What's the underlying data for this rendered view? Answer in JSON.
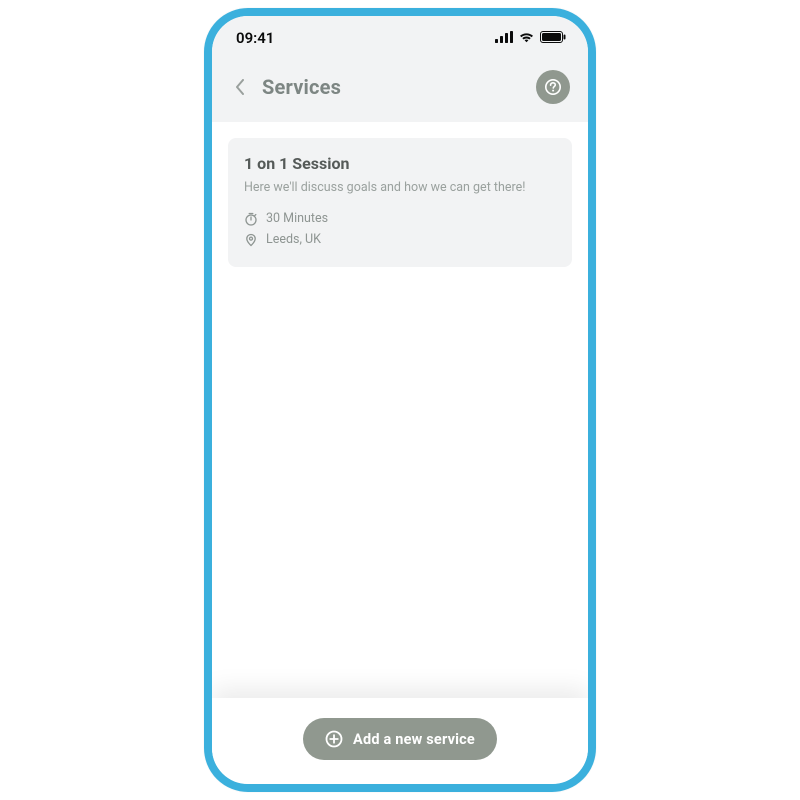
{
  "status_bar": {
    "time": "09:41"
  },
  "header": {
    "title": "Services"
  },
  "services": [
    {
      "title": "1 on 1 Session",
      "description": "Here we'll discuss goals and how we can get there!",
      "duration": "30 Minutes",
      "location": "Leeds, UK"
    }
  ],
  "footer": {
    "add_label": "Add a new service"
  },
  "colors": {
    "frame": "#3bb0dd",
    "accent": "#90988f",
    "card_bg": "#f2f3f4",
    "text_muted": "#8e9592"
  }
}
